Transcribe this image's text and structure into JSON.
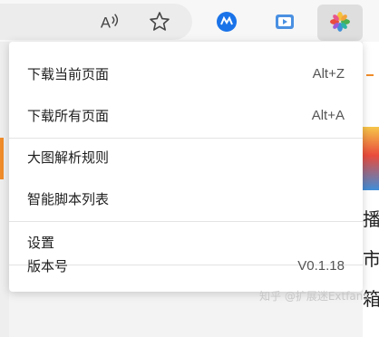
{
  "toolbar": {
    "read_aloud_icon": "read-aloud-icon",
    "favorite_icon": "star-icon",
    "extensions": [
      {
        "name": "blue-ext-icon",
        "color": "#1a73e8"
      },
      {
        "name": "video-ext-icon",
        "color": "#4a90e2"
      },
      {
        "name": "photos-ext-icon",
        "color": "#f2a33a"
      }
    ]
  },
  "menu": {
    "items": [
      {
        "label": "下载当前页面",
        "shortcut": "Alt+Z"
      },
      {
        "label": "下载所有页面",
        "shortcut": "Alt+A"
      },
      {
        "label": "大图解析规则",
        "shortcut": ""
      },
      {
        "label": "智能脚本列表",
        "shortcut": ""
      },
      {
        "label": "设置",
        "shortcut": ""
      },
      {
        "label": "版本号",
        "shortcut": "V0.1.18"
      }
    ]
  },
  "page": {
    "chars": [
      "播",
      "市",
      "箱"
    ]
  },
  "watermark": "知乎 @扩展迷Extfans",
  "colors": {
    "accent": "#f08c2a",
    "menu_bg": "#ffffff"
  }
}
